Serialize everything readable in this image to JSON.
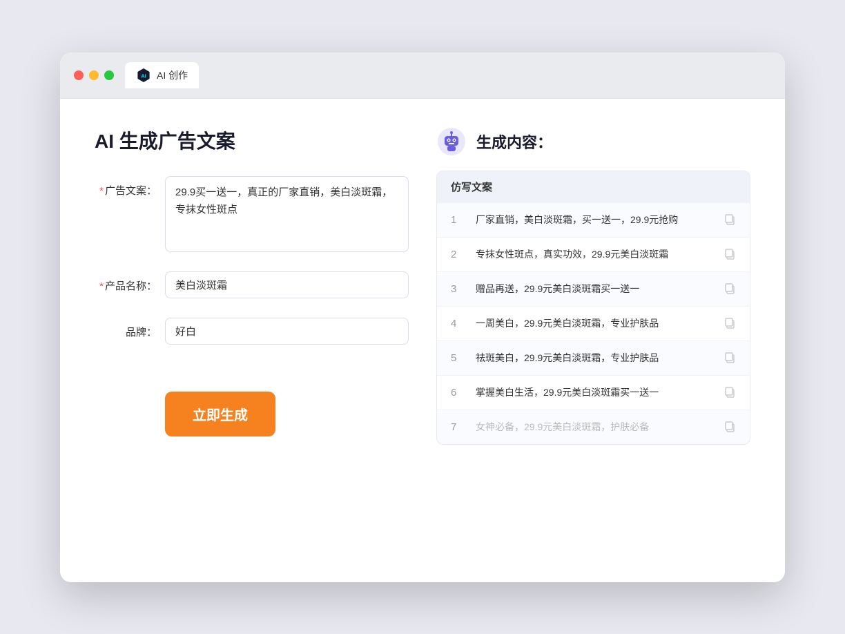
{
  "browser": {
    "tab_title": "AI 创作"
  },
  "left": {
    "page_title": "AI 生成广告文案",
    "ad_copy_label": "广告文案：",
    "ad_copy_value": "29.9买一送一，真正的厂家直销，美白淡斑霜，专抹女性斑点",
    "product_name_label": "产品名称：",
    "product_name_value": "美白淡斑霜",
    "brand_label": "品牌：",
    "brand_value": "好白",
    "submit_label": "立即生成",
    "required_mark": "* "
  },
  "right": {
    "title": "生成内容：",
    "table_header": "仿写文案",
    "rows": [
      {
        "num": "1",
        "text": "厂家直销，美白淡斑霜，买一送一，29.9元抢购",
        "muted": false
      },
      {
        "num": "2",
        "text": "专抹女性斑点，真实功效，29.9元美白淡斑霜",
        "muted": false
      },
      {
        "num": "3",
        "text": "赠品再送，29.9元美白淡斑霜买一送一",
        "muted": false
      },
      {
        "num": "4",
        "text": "一周美白，29.9元美白淡斑霜，专业护肤品",
        "muted": false
      },
      {
        "num": "5",
        "text": "祛斑美白，29.9元美白淡斑霜，专业护肤品",
        "muted": false
      },
      {
        "num": "6",
        "text": "掌握美白生活，29.9元美白淡斑霜买一送一",
        "muted": false
      },
      {
        "num": "7",
        "text": "女神必备，29.9元美白淡斑霜，护肤必备",
        "muted": true
      }
    ]
  }
}
